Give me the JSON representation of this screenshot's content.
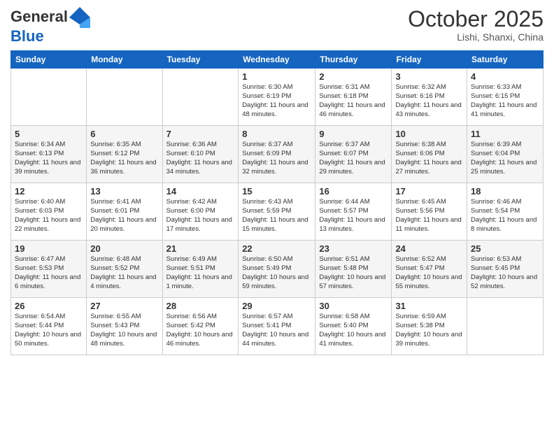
{
  "header": {
    "logo_line1": "General",
    "logo_line2": "Blue",
    "month": "October 2025",
    "location": "Lishi, Shanxi, China"
  },
  "weekdays": [
    "Sunday",
    "Monday",
    "Tuesday",
    "Wednesday",
    "Thursday",
    "Friday",
    "Saturday"
  ],
  "weeks": [
    [
      {
        "day": "",
        "info": ""
      },
      {
        "day": "",
        "info": ""
      },
      {
        "day": "",
        "info": ""
      },
      {
        "day": "1",
        "info": "Sunrise: 6:30 AM\nSunset: 6:19 PM\nDaylight: 11 hours\nand 48 minutes."
      },
      {
        "day": "2",
        "info": "Sunrise: 6:31 AM\nSunset: 6:18 PM\nDaylight: 11 hours\nand 46 minutes."
      },
      {
        "day": "3",
        "info": "Sunrise: 6:32 AM\nSunset: 6:16 PM\nDaylight: 11 hours\nand 43 minutes."
      },
      {
        "day": "4",
        "info": "Sunrise: 6:33 AM\nSunset: 6:15 PM\nDaylight: 11 hours\nand 41 minutes."
      }
    ],
    [
      {
        "day": "5",
        "info": "Sunrise: 6:34 AM\nSunset: 6:13 PM\nDaylight: 11 hours\nand 39 minutes."
      },
      {
        "day": "6",
        "info": "Sunrise: 6:35 AM\nSunset: 6:12 PM\nDaylight: 11 hours\nand 36 minutes."
      },
      {
        "day": "7",
        "info": "Sunrise: 6:36 AM\nSunset: 6:10 PM\nDaylight: 11 hours\nand 34 minutes."
      },
      {
        "day": "8",
        "info": "Sunrise: 6:37 AM\nSunset: 6:09 PM\nDaylight: 11 hours\nand 32 minutes."
      },
      {
        "day": "9",
        "info": "Sunrise: 6:37 AM\nSunset: 6:07 PM\nDaylight: 11 hours\nand 29 minutes."
      },
      {
        "day": "10",
        "info": "Sunrise: 6:38 AM\nSunset: 6:06 PM\nDaylight: 11 hours\nand 27 minutes."
      },
      {
        "day": "11",
        "info": "Sunrise: 6:39 AM\nSunset: 6:04 PM\nDaylight: 11 hours\nand 25 minutes."
      }
    ],
    [
      {
        "day": "12",
        "info": "Sunrise: 6:40 AM\nSunset: 6:03 PM\nDaylight: 11 hours\nand 22 minutes."
      },
      {
        "day": "13",
        "info": "Sunrise: 6:41 AM\nSunset: 6:01 PM\nDaylight: 11 hours\nand 20 minutes."
      },
      {
        "day": "14",
        "info": "Sunrise: 6:42 AM\nSunset: 6:00 PM\nDaylight: 11 hours\nand 17 minutes."
      },
      {
        "day": "15",
        "info": "Sunrise: 6:43 AM\nSunset: 5:59 PM\nDaylight: 11 hours\nand 15 minutes."
      },
      {
        "day": "16",
        "info": "Sunrise: 6:44 AM\nSunset: 5:57 PM\nDaylight: 11 hours\nand 13 minutes."
      },
      {
        "day": "17",
        "info": "Sunrise: 6:45 AM\nSunset: 5:56 PM\nDaylight: 11 hours\nand 11 minutes."
      },
      {
        "day": "18",
        "info": "Sunrise: 6:46 AM\nSunset: 5:54 PM\nDaylight: 11 hours\nand 8 minutes."
      }
    ],
    [
      {
        "day": "19",
        "info": "Sunrise: 6:47 AM\nSunset: 5:53 PM\nDaylight: 11 hours\nand 6 minutes."
      },
      {
        "day": "20",
        "info": "Sunrise: 6:48 AM\nSunset: 5:52 PM\nDaylight: 11 hours\nand 4 minutes."
      },
      {
        "day": "21",
        "info": "Sunrise: 6:49 AM\nSunset: 5:51 PM\nDaylight: 11 hours\nand 1 minute."
      },
      {
        "day": "22",
        "info": "Sunrise: 6:50 AM\nSunset: 5:49 PM\nDaylight: 10 hours\nand 59 minutes."
      },
      {
        "day": "23",
        "info": "Sunrise: 6:51 AM\nSunset: 5:48 PM\nDaylight: 10 hours\nand 57 minutes."
      },
      {
        "day": "24",
        "info": "Sunrise: 6:52 AM\nSunset: 5:47 PM\nDaylight: 10 hours\nand 55 minutes."
      },
      {
        "day": "25",
        "info": "Sunrise: 6:53 AM\nSunset: 5:45 PM\nDaylight: 10 hours\nand 52 minutes."
      }
    ],
    [
      {
        "day": "26",
        "info": "Sunrise: 6:54 AM\nSunset: 5:44 PM\nDaylight: 10 hours\nand 50 minutes."
      },
      {
        "day": "27",
        "info": "Sunrise: 6:55 AM\nSunset: 5:43 PM\nDaylight: 10 hours\nand 48 minutes."
      },
      {
        "day": "28",
        "info": "Sunrise: 6:56 AM\nSunset: 5:42 PM\nDaylight: 10 hours\nand 46 minutes."
      },
      {
        "day": "29",
        "info": "Sunrise: 6:57 AM\nSunset: 5:41 PM\nDaylight: 10 hours\nand 44 minutes."
      },
      {
        "day": "30",
        "info": "Sunrise: 6:58 AM\nSunset: 5:40 PM\nDaylight: 10 hours\nand 41 minutes."
      },
      {
        "day": "31",
        "info": "Sunrise: 6:59 AM\nSunset: 5:38 PM\nDaylight: 10 hours\nand 39 minutes."
      },
      {
        "day": "",
        "info": ""
      }
    ]
  ]
}
